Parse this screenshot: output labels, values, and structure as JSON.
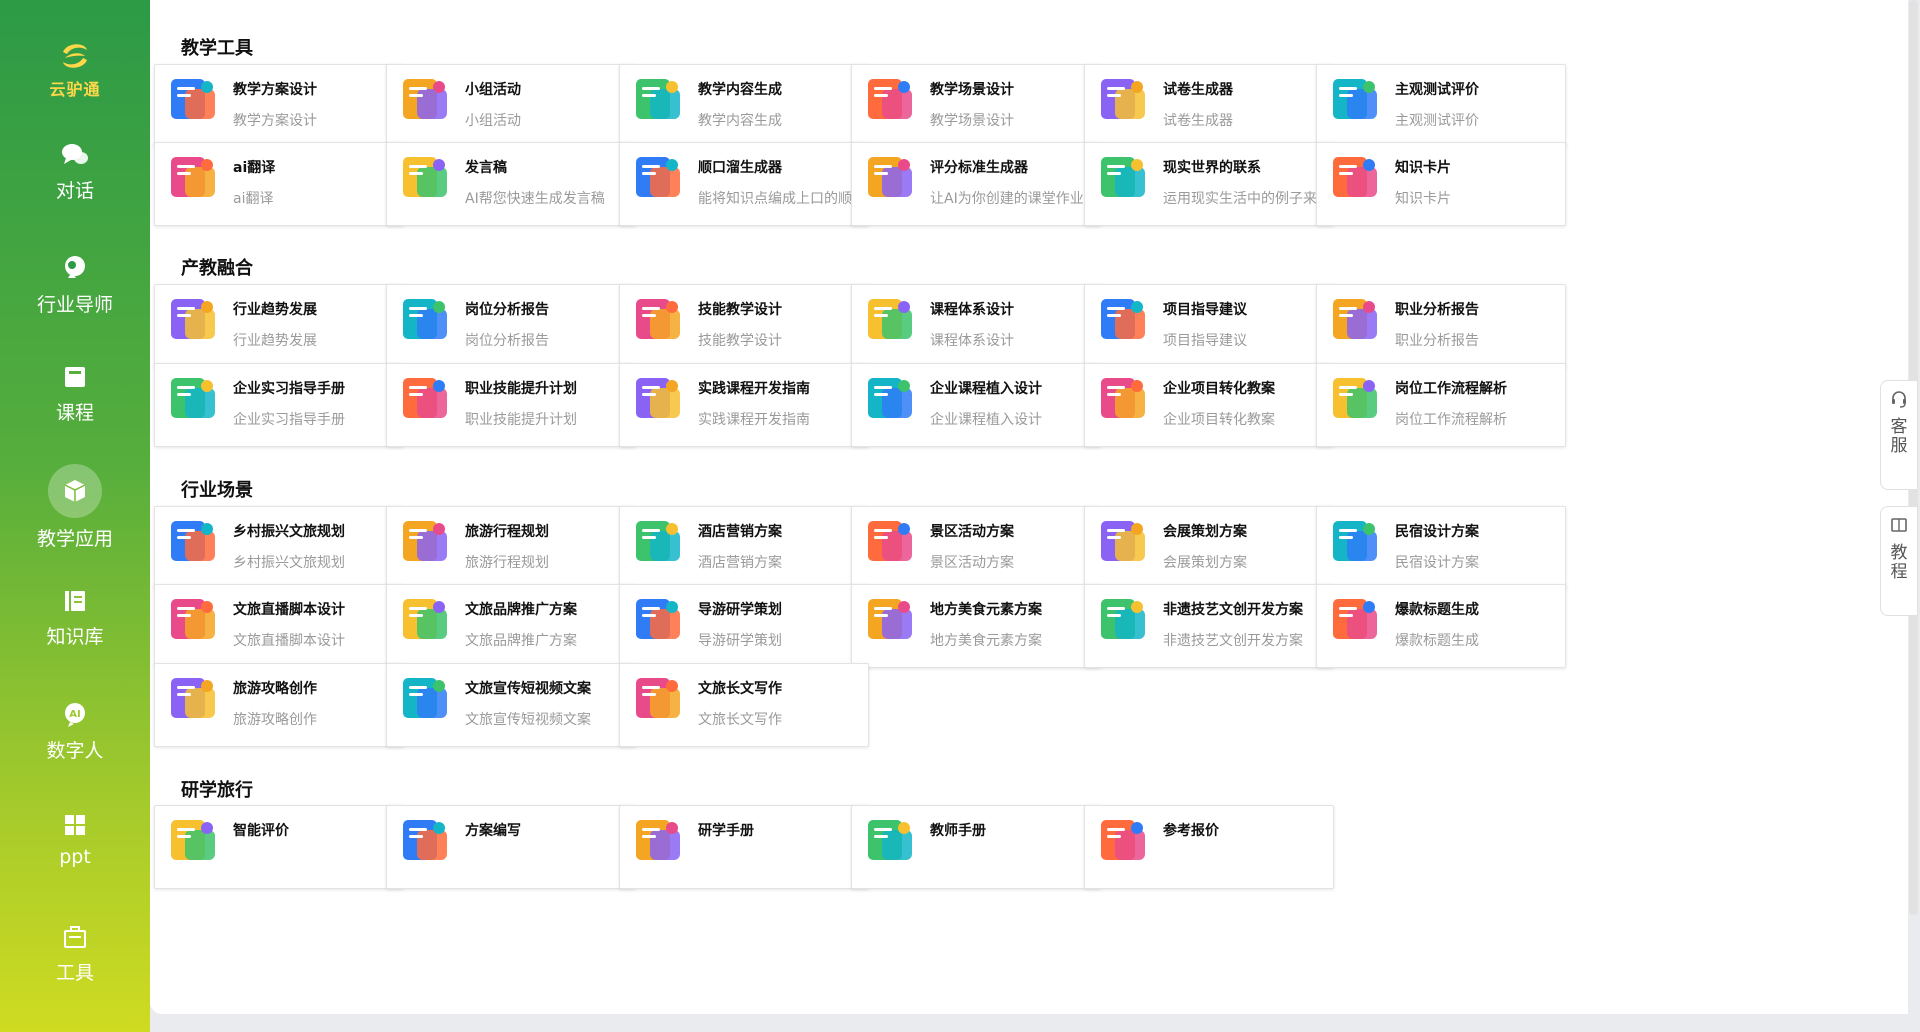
{
  "logo": {
    "text": "云驴通"
  },
  "nav": [
    {
      "label": "对话",
      "icon": "chat-icon"
    },
    {
      "label": "行业导师",
      "icon": "mentor-icon"
    },
    {
      "label": "课程",
      "icon": "course-icon"
    },
    {
      "label": "教学应用",
      "icon": "cube-icon",
      "active": true
    },
    {
      "label": "知识库",
      "icon": "book-icon"
    },
    {
      "label": "数字人",
      "icon": "ai-avatar-icon"
    },
    {
      "label": "ppt",
      "icon": "grid-icon"
    },
    {
      "label": "工具",
      "icon": "toolbox-icon"
    }
  ],
  "sections": [
    {
      "title": "教学工具",
      "cards": [
        {
          "title": "教学方案设计",
          "sub": "教学方案设计",
          "icon": "document-blue-icon"
        },
        {
          "title": "小组活动",
          "sub": "小组活动",
          "icon": "group-icon"
        },
        {
          "title": "教学内容生成",
          "sub": "教学内容生成",
          "icon": "check-note-icon"
        },
        {
          "title": "教学场景设计",
          "sub": "教学场景设计",
          "icon": "scene-icon"
        },
        {
          "title": "试卷生成器",
          "sub": "试卷生成器",
          "icon": "exam-paper-icon"
        },
        {
          "title": "主观测试评价",
          "sub": "主观测试评价",
          "icon": "presentation-board-icon"
        },
        {
          "title": "ai翻译",
          "sub": "ai翻译",
          "icon": "translate-a-icon"
        },
        {
          "title": "发言稿",
          "sub": "AI帮您快速生成发言稿",
          "icon": "speech-lines-icon"
        },
        {
          "title": "顺口溜生成器",
          "sub": "能将知识点编成上口的顺口溜",
          "icon": "rhyme-icon"
        },
        {
          "title": "评分标准生成器",
          "sub": "让AI为你创建的课堂作业生成评分标准",
          "icon": "rating-stars-icon"
        },
        {
          "title": "现实世界的联系",
          "sub": "运用现实生活中的例子来解释知识点",
          "icon": "rocket-globe-icon"
        },
        {
          "title": "知识卡片",
          "sub": "知识卡片",
          "icon": "star-card-icon"
        }
      ]
    },
    {
      "title": "产教融合",
      "cards": [
        {
          "title": "行业趋势发展",
          "sub": "行业趋势发展",
          "icon": "trend-chart-icon"
        },
        {
          "title": "岗位分析报告",
          "sub": "岗位分析报告",
          "icon": "person-analysis-icon"
        },
        {
          "title": "技能教学设计",
          "sub": "技能教学设计",
          "icon": "pencil-icon"
        },
        {
          "title": "课程体系设计",
          "sub": "课程体系设计",
          "icon": "monitor-icon"
        },
        {
          "title": "项目指导建议",
          "sub": "项目指导建议",
          "icon": "edit-note-icon"
        },
        {
          "title": "职业分析报告",
          "sub": "职业分析报告",
          "icon": "report-chart-icon"
        },
        {
          "title": "企业实习指导手册",
          "sub": "企业实习指导手册",
          "icon": "handbook-icon"
        },
        {
          "title": "职业技能提升计划",
          "sub": "职业技能提升计划",
          "icon": "book-split-icon"
        },
        {
          "title": "实践课程开发指南",
          "sub": "实践课程开发指南",
          "icon": "open-book-icon"
        },
        {
          "title": "企业课程植入设计",
          "sub": "企业课程植入设计",
          "icon": "globe-books-icon"
        },
        {
          "title": "企业项目转化教案",
          "sub": "企业项目转化教案",
          "icon": "folder-icon"
        },
        {
          "title": "岗位工作流程解析",
          "sub": "岗位工作流程解析",
          "icon": "checklist-icon"
        }
      ]
    },
    {
      "title": "行业场景",
      "cards": [
        {
          "title": "乡村振兴文旅规划",
          "sub": "乡村振兴文旅规划",
          "icon": "island-icon"
        },
        {
          "title": "旅游行程规划",
          "sub": "旅游行程规划",
          "icon": "itinerary-icon"
        },
        {
          "title": "酒店营销方案",
          "sub": "酒店营销方案",
          "icon": "hotel-icon"
        },
        {
          "title": "景区活动方案",
          "sub": "景区活动方案",
          "icon": "mountain-icon"
        },
        {
          "title": "会展策划方案",
          "sub": "会展策划方案",
          "icon": "exhibition-icon"
        },
        {
          "title": "民宿设计方案",
          "sub": "民宿设计方案",
          "icon": "house-icon"
        },
        {
          "title": "文旅直播脚本设计",
          "sub": "文旅直播脚本设计",
          "icon": "play-video-icon"
        },
        {
          "title": "文旅品牌推广方案",
          "sub": "文旅品牌推广方案",
          "icon": "landscape-icon"
        },
        {
          "title": "导游研学策划",
          "sub": "导游研学策划",
          "icon": "map-pin-icon"
        },
        {
          "title": "地方美食元素方案",
          "sub": "地方美食元素方案",
          "icon": "wok-icon"
        },
        {
          "title": "非遗技艺文创开发方案",
          "sub": "非遗技艺文创开发方案",
          "icon": "opera-mask-icon"
        },
        {
          "title": "爆款标题生成",
          "sub": "爆款标题生成",
          "icon": "hot-badge-icon"
        },
        {
          "title": "旅游攻略创作",
          "sub": "旅游攻略创作",
          "icon": "treasure-map-icon"
        },
        {
          "title": "文旅宣传短视频文案",
          "sub": "文旅宣传短视频文案",
          "icon": "short-video-icon"
        },
        {
          "title": "文旅长文写作",
          "sub": "文旅长文写作",
          "icon": "long-article-icon"
        }
      ]
    },
    {
      "title": "研学旅行",
      "cards": [
        {
          "title": "智能评价",
          "sub": "",
          "icon": "smart-eval-icon"
        },
        {
          "title": "方案编写",
          "sub": "",
          "icon": "plan-writing-icon"
        },
        {
          "title": "研学手册",
          "sub": "",
          "icon": "study-manual-icon"
        },
        {
          "title": "教师手册",
          "sub": "",
          "icon": "teacher-manual-icon"
        },
        {
          "title": "参考报价",
          "sub": "",
          "icon": "quote-icon"
        }
      ]
    }
  ],
  "side_tabs": [
    {
      "label": "客服",
      "icon": "headset-icon"
    },
    {
      "label": "教程",
      "icon": "tutorial-book-icon"
    }
  ],
  "colors": {
    "sidebar_top": "#2c9a46",
    "sidebar_bottom": "#cfdb21",
    "logo": "#ffd84a"
  }
}
